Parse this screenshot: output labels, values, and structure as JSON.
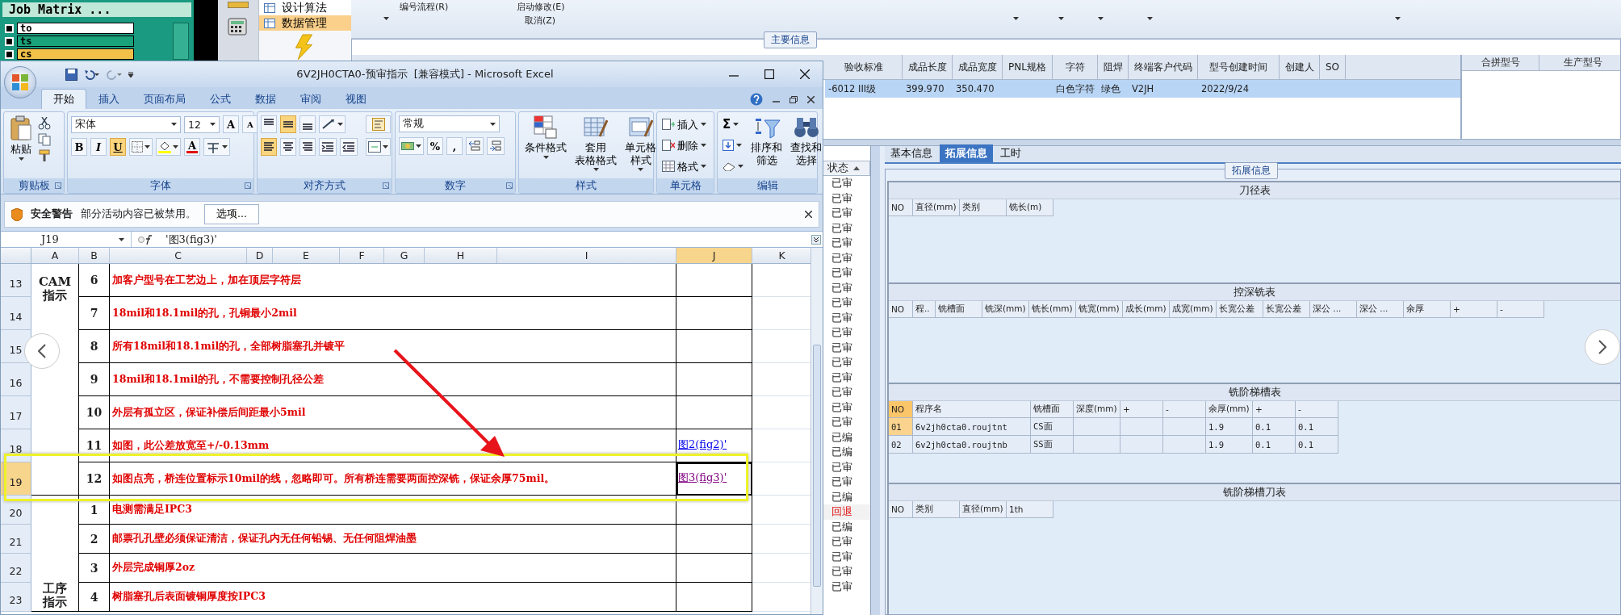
{
  "job_matrix": {
    "title": "Job Matrix ...",
    "items": [
      {
        "label": "to",
        "color": "#ffffff"
      },
      {
        "label": "ts",
        "color": "#1aa37a"
      },
      {
        "label": "cs",
        "color": "#f2c14a"
      }
    ]
  },
  "launcher_menu": [
    {
      "label": "设计算法",
      "selected": false
    },
    {
      "label": "数据管理",
      "selected": true
    }
  ],
  "toolbar": {
    "items": [
      "编号流程(R)",
      "启动修改(E)",
      "取消(Z)"
    ]
  },
  "main_info": {
    "legend": "主要信息",
    "columns": [
      "验收标准",
      "成品长度",
      "成品宽度",
      "PNL规格",
      "字符",
      "阻焊",
      "终端客户代码",
      "型号创建时间",
      "创建人",
      "SO"
    ],
    "rows": [
      {
        "selected": true,
        "cells": [
          "-6012 III级",
          "399.970",
          "350.470",
          null,
          "白色字符",
          "绿色",
          "V2JH",
          "2022/9/24",
          null,
          null
        ]
      }
    ],
    "side_columns": [
      "合拼型号",
      "生产型号"
    ]
  },
  "status_list": {
    "header": "状态",
    "items": [
      {
        "label": "已审",
        "kind": "normal"
      },
      {
        "label": "已审",
        "kind": "normal"
      },
      {
        "label": "已审",
        "kind": "normal"
      },
      {
        "label": "已审",
        "kind": "normal"
      },
      {
        "label": "已审",
        "kind": "normal"
      },
      {
        "label": "已审",
        "kind": "normal"
      },
      {
        "label": "已审",
        "kind": "normal"
      },
      {
        "label": "已审",
        "kind": "normal"
      },
      {
        "label": "已审",
        "kind": "normal"
      },
      {
        "label": "已审",
        "kind": "normal"
      },
      {
        "label": "已审",
        "kind": "normal"
      },
      {
        "label": "已审",
        "kind": "normal"
      },
      {
        "label": "已审",
        "kind": "normal"
      },
      {
        "label": "已审",
        "kind": "normal"
      },
      {
        "label": "已审",
        "kind": "normal"
      },
      {
        "label": "已审",
        "kind": "normal"
      },
      {
        "label": "已审",
        "kind": "normal"
      },
      {
        "label": "已编",
        "kind": "normal"
      },
      {
        "label": "已编",
        "kind": "normal"
      },
      {
        "label": "已审",
        "kind": "normal"
      },
      {
        "label": "已审",
        "kind": "normal"
      },
      {
        "label": "已编",
        "kind": "normal"
      },
      {
        "label": "回退",
        "kind": "returned"
      },
      {
        "label": "已编",
        "kind": "normal"
      },
      {
        "label": "已审",
        "kind": "normal"
      },
      {
        "label": "已审",
        "kind": "normal"
      },
      {
        "label": "已审",
        "kind": "normal"
      },
      {
        "label": "已审",
        "kind": "normal"
      }
    ]
  },
  "detail_tabs": [
    {
      "label": "基本信息",
      "selected": false
    },
    {
      "label": "拓展信息",
      "selected": true
    },
    {
      "label": "工时",
      "selected": false
    }
  ],
  "extended_info": {
    "legend": "拓展信息",
    "tables": [
      {
        "title": "刀径表",
        "columns": [
          "NO",
          "直径(mm)",
          "类别",
          "铣长(m)"
        ]
      },
      {
        "title": "控深铣表",
        "columns": [
          "NO",
          "程..",
          "铣槽面",
          "铣深(mm)",
          "铣长(mm)",
          "铣宽(mm)",
          "成长(mm)",
          "成宽(mm)",
          "长宽公差",
          "长宽公差",
          "深公 ...",
          "深公 ...",
          "余厚",
          "+",
          "-"
        ]
      },
      {
        "title": "铣阶梯槽表",
        "columns": [
          "NO",
          "程序名",
          "铣槽面",
          "深度(mm)",
          "+",
          "-",
          "余厚(mm)",
          "+",
          "-"
        ],
        "rows": [
          {
            "selected": true,
            "cells": [
              "01",
              "6v2jh0cta0.roujtnt",
              "CS面",
              null,
              null,
              null,
              "1.9",
              "0.1",
              "0.1"
            ]
          },
          {
            "selected": false,
            "cells": [
              "02",
              "6v2jh0cta0.roujtnb",
              "SS面",
              null,
              null,
              null,
              "1.9",
              "0.1",
              "0.1"
            ]
          }
        ]
      },
      {
        "title": "铣阶梯槽刀表",
        "columns": [
          "NO",
          "类别",
          "直径(mm)",
          "1th"
        ]
      }
    ]
  },
  "excel": {
    "title": "6V2JH0CTA0-预审指示  [兼容模式] - Microsoft Excel",
    "tabs": [
      {
        "label": "开始",
        "selected": true
      },
      {
        "label": "插入",
        "selected": false
      },
      {
        "label": "页面布局",
        "selected": false
      },
      {
        "label": "公式",
        "selected": false
      },
      {
        "label": "数据",
        "selected": false
      },
      {
        "label": "审阅",
        "selected": false
      },
      {
        "label": "视图",
        "selected": false
      }
    ],
    "ribbon": [
      {
        "kind": "clipboard",
        "label": "剪贴板",
        "paste": "粘贴"
      },
      {
        "kind": "font",
        "label": "字体",
        "font": "宋体",
        "size": "12",
        "grow": "A",
        "shrink": "A",
        "font_color": "A",
        "styles": [
          {
            "label": "B",
            "selected": false
          },
          {
            "label": "I",
            "selected": false
          },
          {
            "label": "U",
            "selected": true
          }
        ]
      },
      {
        "kind": "alignment",
        "label": "对齐方式",
        "vertical": [
          {
            "selected": false
          },
          {
            "selected": true
          },
          {
            "selected": false
          }
        ],
        "horizontal": [
          {
            "selected": true
          },
          {
            "selected": false
          },
          {
            "selected": false
          }
        ]
      },
      {
        "kind": "number",
        "label": "数字",
        "format": "常规",
        "symbols": [
          "%",
          ","
        ]
      },
      {
        "kind": "styles",
        "label": "样式",
        "buttons": [
          [
            "条件格式"
          ],
          [
            "套用",
            "表格格式"
          ],
          [
            "单元格",
            "样式"
          ]
        ]
      },
      {
        "kind": "cells",
        "label": "单元格",
        "buttons": [
          "插入",
          "删除",
          "格式"
        ]
      },
      {
        "kind": "editing",
        "label": "编辑",
        "sum": "Σ",
        "buttons": [
          [
            "排序和",
            "筛选"
          ],
          [
            "查找和",
            "选择"
          ]
        ]
      }
    ],
    "security_bar": {
      "title": "安全警告",
      "message": "部分活动内容已被禁用。",
      "button": "选项..."
    },
    "formula_bar": {
      "name_box": "J19",
      "formula": "'图3(fig3)'"
    },
    "sheet": {
      "columns": [
        {
          "label": "A",
          "selected": false
        },
        {
          "label": "B",
          "selected": false
        },
        {
          "label": "C",
          "selected": false
        },
        {
          "label": "D",
          "selected": false
        },
        {
          "label": "E",
          "selected": false
        },
        {
          "label": "F",
          "selected": false
        },
        {
          "label": "G",
          "selected": false
        },
        {
          "label": "H",
          "selected": false
        },
        {
          "label": "I",
          "selected": false
        },
        {
          "label": "J",
          "selected": true
        },
        {
          "label": "K",
          "selected": false
        }
      ],
      "row_groups": [
        {
          "label": [
            "CAM",
            "指示"
          ],
          "rows": [
            {
              "number": "13",
              "selected": false,
              "index": "6",
              "text": "加客户型号在工艺边上，加在顶层字符层"
            },
            {
              "number": "14",
              "selected": false,
              "index": "7",
              "text": "18mil和18.1mil的孔，孔铜最小2mil"
            },
            {
              "number": "15",
              "selected": false,
              "index": "8",
              "text": "所有18mil和18.1mil的孔，全部树脂塞孔并镀平"
            },
            {
              "number": "16",
              "selected": false,
              "index": "9",
              "text": "18mil和18.1mil的孔，不需要控制孔径公差"
            },
            {
              "number": "17",
              "selected": false,
              "index": "10",
              "text": "外层有孤立区，保证补偿后间距最小5mil"
            },
            {
              "number": "18",
              "selected": false,
              "index": "11",
              "text": "如图，此公差放宽至+/-0.13mm",
              "link": {
                "label": "图2(fig2)'",
                "visited": false
              }
            },
            {
              "number": "19",
              "selected": true,
              "index": "12",
              "text": "如图点亮，桥连位置标示10mil的线，忽略即可。所有桥连需要两面控深铣，保证余厚75mil。",
              "link": {
                "label": "图3(fig3)'",
                "visited": true
              }
            }
          ]
        },
        {
          "label": [
            "工序",
            "指示"
          ],
          "rows": [
            {
              "number": "20",
              "selected": false,
              "index": "1",
              "text": "电测需满足IPC3"
            },
            {
              "number": "21",
              "selected": false,
              "index": "2",
              "text": "邮票孔孔壁必须保证清洁，保证孔内无任何铅锡、无任何阻焊油墨"
            },
            {
              "number": "22",
              "selected": false,
              "index": "3",
              "text": "外层完成铜厚2oz"
            },
            {
              "number": "23",
              "selected": false,
              "index": "4",
              "text": "树脂塞孔后表面镀铜厚度按IPC3"
            }
          ]
        }
      ]
    }
  }
}
